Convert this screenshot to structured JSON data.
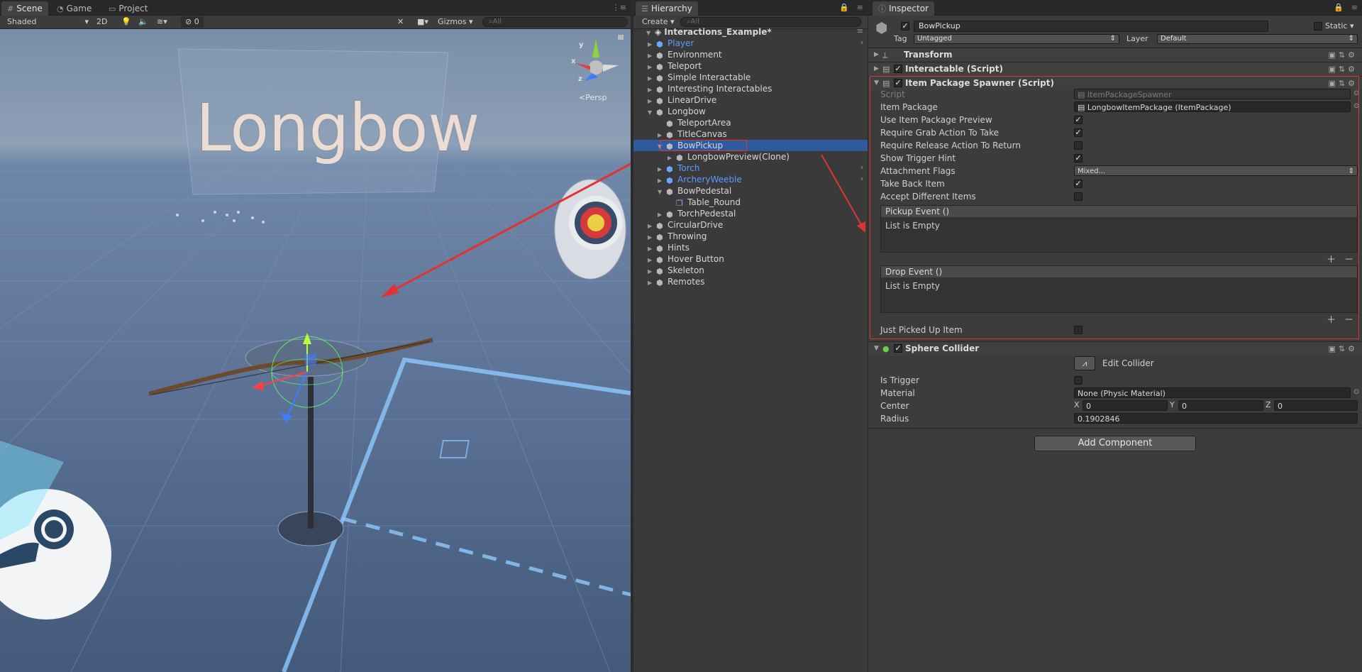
{
  "scene_panel": {
    "tabs": [
      {
        "label": "Scene",
        "icon": "hash-icon"
      },
      {
        "label": "Game",
        "icon": "pacman-icon"
      },
      {
        "label": "Project",
        "icon": "folder-icon"
      }
    ],
    "toolbar": {
      "shading": "Shaded",
      "mode2d": "2D",
      "hidden_count": "0",
      "gizmos": "Gizmos",
      "search_placeholder": "All"
    },
    "title_text": "Longbow",
    "persp_label": "Persp",
    "gizmo_axes": {
      "x": "x",
      "y": "y",
      "z": "z"
    }
  },
  "hierarchy": {
    "tab": "Hierarchy",
    "create_label": "Create",
    "search_placeholder": "All",
    "scene_name": "Interactions_Example*",
    "rows": [
      {
        "label": "Player",
        "blue": true,
        "indent": 1,
        "fold": "closed",
        "arrow": true
      },
      {
        "label": "Environment",
        "indent": 1,
        "fold": "closed"
      },
      {
        "label": "Teleport",
        "indent": 1,
        "fold": "closed"
      },
      {
        "label": "Simple Interactable",
        "indent": 1,
        "fold": "closed"
      },
      {
        "label": "Interesting Interactables",
        "indent": 1,
        "fold": "closed"
      },
      {
        "label": "LinearDrive",
        "indent": 1,
        "fold": "closed"
      },
      {
        "label": "Longbow",
        "indent": 1,
        "fold": "open"
      },
      {
        "label": "TeleportArea",
        "indent": 2,
        "fold": "none"
      },
      {
        "label": "TitleCanvas",
        "indent": 2,
        "fold": "closed"
      },
      {
        "label": "BowPickup",
        "indent": 2,
        "fold": "open",
        "selected": true
      },
      {
        "label": "LongbowPreview(Clone)",
        "indent": 3,
        "fold": "closed"
      },
      {
        "label": "Torch",
        "blue": true,
        "indent": 2,
        "fold": "closed",
        "arrow": true
      },
      {
        "label": "ArcheryWeeble",
        "blue": true,
        "indent": 2,
        "fold": "closed",
        "arrow": true
      },
      {
        "label": "BowPedestal",
        "indent": 2,
        "fold": "open"
      },
      {
        "label": "Table_Round",
        "indent": 3,
        "fold": "none",
        "prefab": true
      },
      {
        "label": "TorchPedestal",
        "indent": 2,
        "fold": "closed"
      },
      {
        "label": "CircularDrive",
        "indent": 1,
        "fold": "closed"
      },
      {
        "label": "Throwing",
        "indent": 1,
        "fold": "closed"
      },
      {
        "label": "Hints",
        "indent": 1,
        "fold": "closed"
      },
      {
        "label": "Hover Button",
        "indent": 1,
        "fold": "closed"
      },
      {
        "label": "Skeleton",
        "indent": 1,
        "fold": "closed"
      },
      {
        "label": "Remotes",
        "indent": 1,
        "fold": "closed"
      }
    ]
  },
  "inspector": {
    "tab": "Inspector",
    "object_name": "BowPickup",
    "static_label": "Static",
    "tag_label": "Tag",
    "tag_value": "Untagged",
    "layer_label": "Layer",
    "layer_value": "Default",
    "components": {
      "transform": "Transform",
      "interactable": "Interactable (Script)",
      "spawner": "Item Package Spawner (Script)",
      "collider": "Sphere Collider"
    },
    "spawner_fields": [
      {
        "label": "Script",
        "value": "ItemPackageSpawner",
        "kind": "obj",
        "dim": true
      },
      {
        "label": "Item Package",
        "value": "LongbowItemPackage (ItemPackage)",
        "kind": "obj"
      },
      {
        "label": "Use Item Package Preview",
        "checked": true,
        "kind": "bool"
      },
      {
        "label": "Require Grab Action To Take",
        "checked": true,
        "kind": "bool"
      },
      {
        "label": "Require Release Action To Return",
        "checked": false,
        "kind": "bool"
      },
      {
        "label": "Show Trigger Hint",
        "checked": true,
        "kind": "bool"
      },
      {
        "label": "Attachment Flags",
        "value": "Mixed...",
        "kind": "enum"
      },
      {
        "label": "Take Back Item",
        "checked": true,
        "kind": "bool"
      },
      {
        "label": "Accept Different Items",
        "checked": false,
        "kind": "bool"
      }
    ],
    "pickup_event": {
      "title": "Pickup Event ()",
      "body": "List is Empty"
    },
    "drop_event": {
      "title": "Drop Event ()",
      "body": "List is Empty"
    },
    "just_picked_up": "Just Picked Up Item",
    "edit_collider": "Edit Collider",
    "collider_fields": {
      "is_trigger": "Is Trigger",
      "material_label": "Material",
      "material_value": "None (Physic Material)",
      "center_label": "Center",
      "cx_label": "X",
      "cx": "0",
      "cy_label": "Y",
      "cy": "0",
      "cz_label": "Z",
      "cz": "0",
      "radius_label": "Radius",
      "radius": "0.1902846"
    },
    "add_component": "Add Component"
  },
  "colors": {
    "accent_red": "#e03434",
    "selection": "#2f5a9e",
    "prefab_blue": "#5a9cff"
  }
}
